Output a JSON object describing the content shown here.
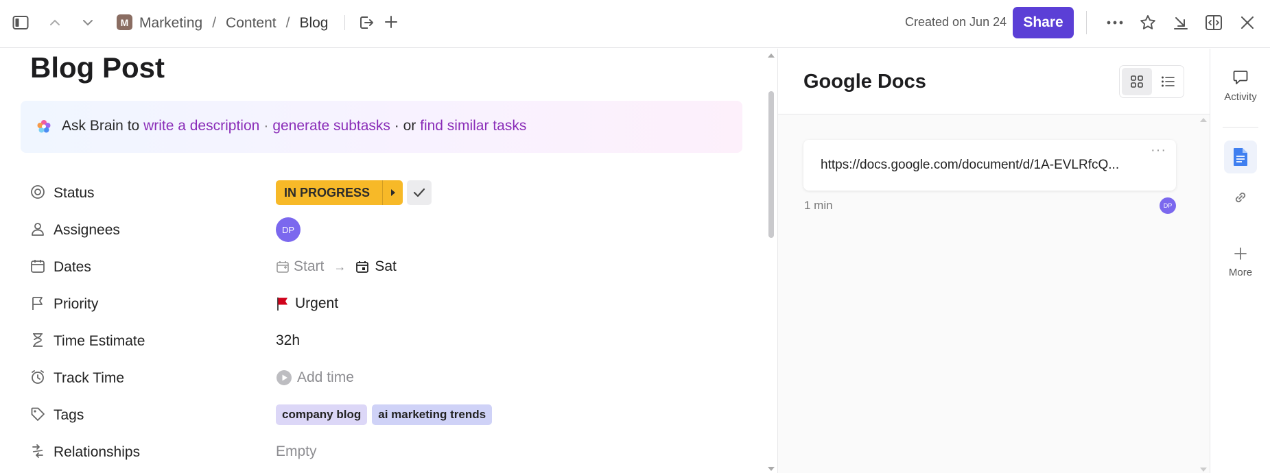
{
  "topbar": {
    "breadcrumb": {
      "space_initial": "M",
      "items": [
        "Marketing",
        "Content",
        "Blog"
      ],
      "separator": "/"
    },
    "created_text": "Created on Jun 24",
    "share_label": "Share"
  },
  "task": {
    "title": "Blog Post",
    "brain": {
      "prefix": "Ask Brain to",
      "link1": "write a description",
      "dot": "·",
      "link2": "generate subtasks",
      "or": "· or",
      "link3": "find similar tasks"
    },
    "fields": {
      "status": {
        "label": "Status",
        "value": "IN PROGRESS",
        "color": "#f7b928"
      },
      "assignees": {
        "label": "Assignees",
        "initials": "DP"
      },
      "dates": {
        "label": "Dates",
        "start": "Start",
        "arrow": "→",
        "due": "Sat"
      },
      "priority": {
        "label": "Priority",
        "value": "Urgent",
        "flag_color": "#d0021b"
      },
      "time_estimate": {
        "label": "Time Estimate",
        "value": "32h"
      },
      "track_time": {
        "label": "Track Time",
        "value": "Add time"
      },
      "tags": {
        "label": "Tags",
        "items": [
          "company blog",
          "ai marketing trends"
        ]
      },
      "relationships": {
        "label": "Relationships",
        "value": "Empty"
      }
    }
  },
  "panel": {
    "title": "Google Docs",
    "doc": {
      "url": "https://docs.google.com/document/d/1A-EVLRfcQ...",
      "more": "···",
      "time": "1 min",
      "avatar": "DP"
    }
  },
  "rail": {
    "activity_label": "Activity",
    "more_label": "More"
  },
  "colors": {
    "accent": "#5b3fd6",
    "brain_link": "#8a2db8",
    "avatar": "#7b68ee"
  }
}
